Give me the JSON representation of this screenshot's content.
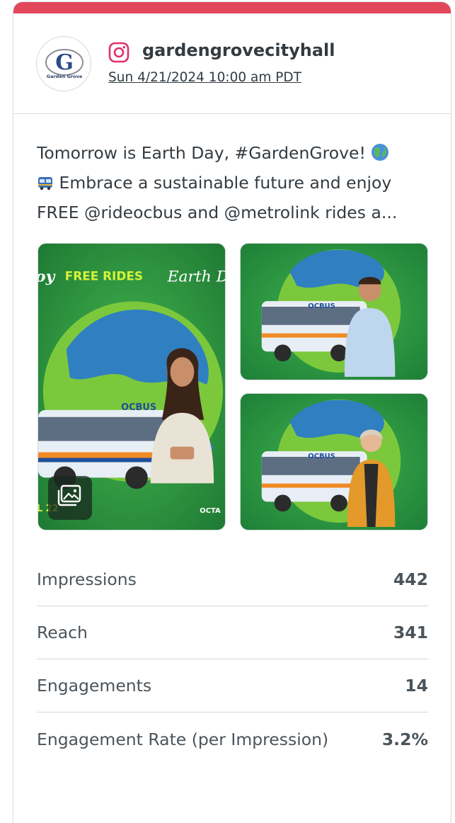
{
  "colors": {
    "accent_bar": "#e2475b",
    "text": "#333b41",
    "border": "#d8dcdf",
    "instagram": "#e1306c"
  },
  "post": {
    "avatar_logo_letter": "G",
    "avatar_logo_text": "Garden Grove",
    "network_icon": "instagram-icon",
    "handle": "gardengrovecityhall",
    "date": "Sun 4/21/2024 10:00 am PDT",
    "caption_lines": [
      "Tomorrow is Earth Day, #GardenGrove!",
      "Embrace a sustainable future and enjoy",
      "FREE @rideocbus and @metrolink rides a..."
    ],
    "media": {
      "main_banner_left": "oy",
      "main_banner_free": "FREE RIDES",
      "main_banner_earth": "Earth D",
      "main_footer_left": "L 22",
      "main_footer_right": "OCTA",
      "bus_logo": "OCBUS",
      "gallery_icon": "image-gallery-icon"
    }
  },
  "metrics": [
    {
      "label": "Impressions",
      "value": "442"
    },
    {
      "label": "Reach",
      "value": "341"
    },
    {
      "label": "Engagements",
      "value": "14"
    },
    {
      "label": "Engagement Rate (per Impression)",
      "value": "3.2%"
    }
  ]
}
